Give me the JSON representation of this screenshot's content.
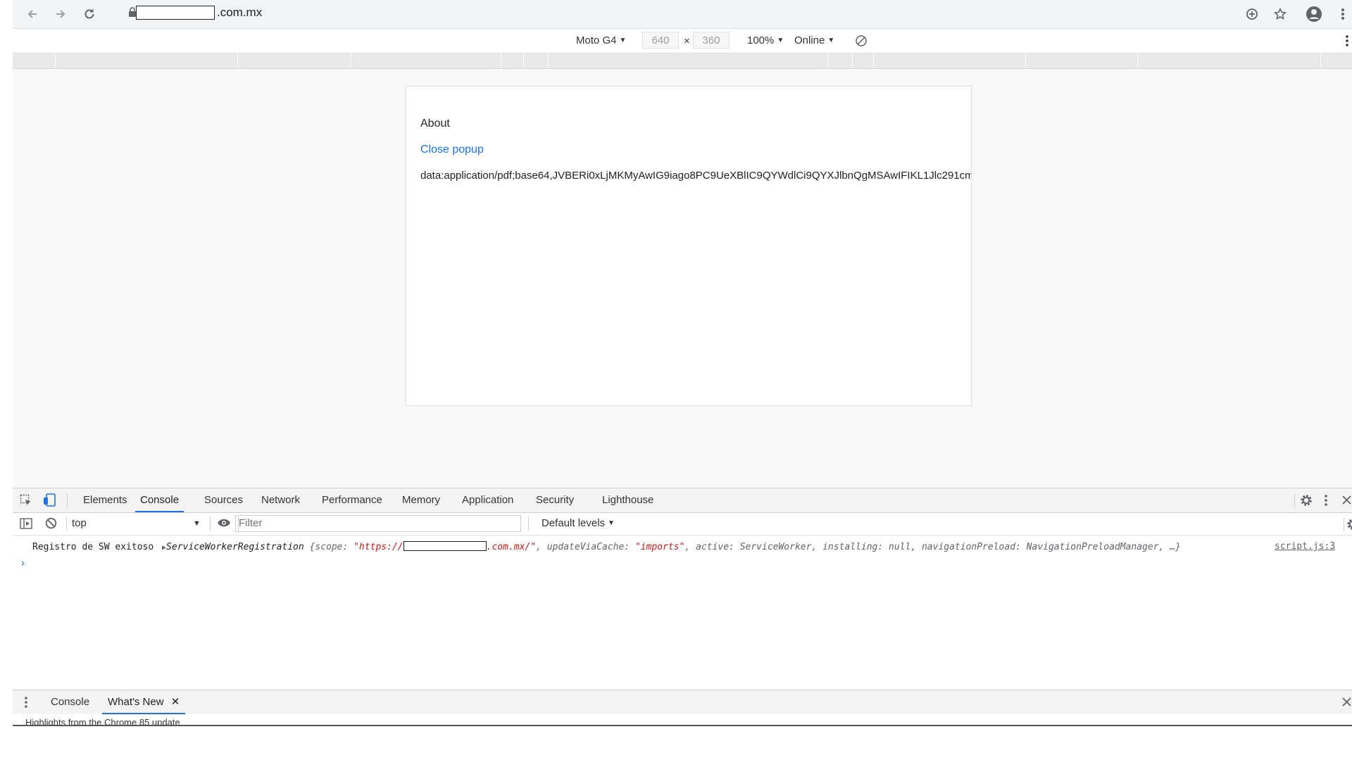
{
  "browser": {
    "url_suffix": ".com.mx"
  },
  "device_toolbar": {
    "device": "Moto G4",
    "width": "640",
    "times": "×",
    "height": "360",
    "zoom": "100%",
    "network": "Online"
  },
  "page": {
    "about": "About",
    "close_popup": "Close popup",
    "data_uri": "data:application/pdf;base64,JVBERi0xLjMKMyAwIG9iago8PC9UeXBlIC9QYWdlCi9QYXJlbnQgMSAwIFIKL1Jlc291cm"
  },
  "devtools": {
    "tabs": [
      "Elements",
      "Console",
      "Sources",
      "Network",
      "Performance",
      "Memory",
      "Application",
      "Security",
      "Lighthouse"
    ],
    "context": "top",
    "filter_placeholder": "Filter",
    "levels": "Default levels",
    "log": {
      "message": "Registro de SW exitoso",
      "object_class": "ServiceWorkerRegistration",
      "scope_key": "{scope: ",
      "scope_prefix": "\"https://",
      "scope_suffix": ".com.mx/\"",
      "rest_1": ", updateViaCache: ",
      "update_value": "\"imports\"",
      "rest_2": ", active: ServiceWorker, installing: null, navigationPreload: NavigationPreloadManager, …}",
      "source": "script.js:3"
    },
    "prompt_symbol": "›"
  },
  "drawer": {
    "tabs": [
      "Console",
      "What's New"
    ],
    "content": "Highlights from the Chrome 85 update"
  }
}
